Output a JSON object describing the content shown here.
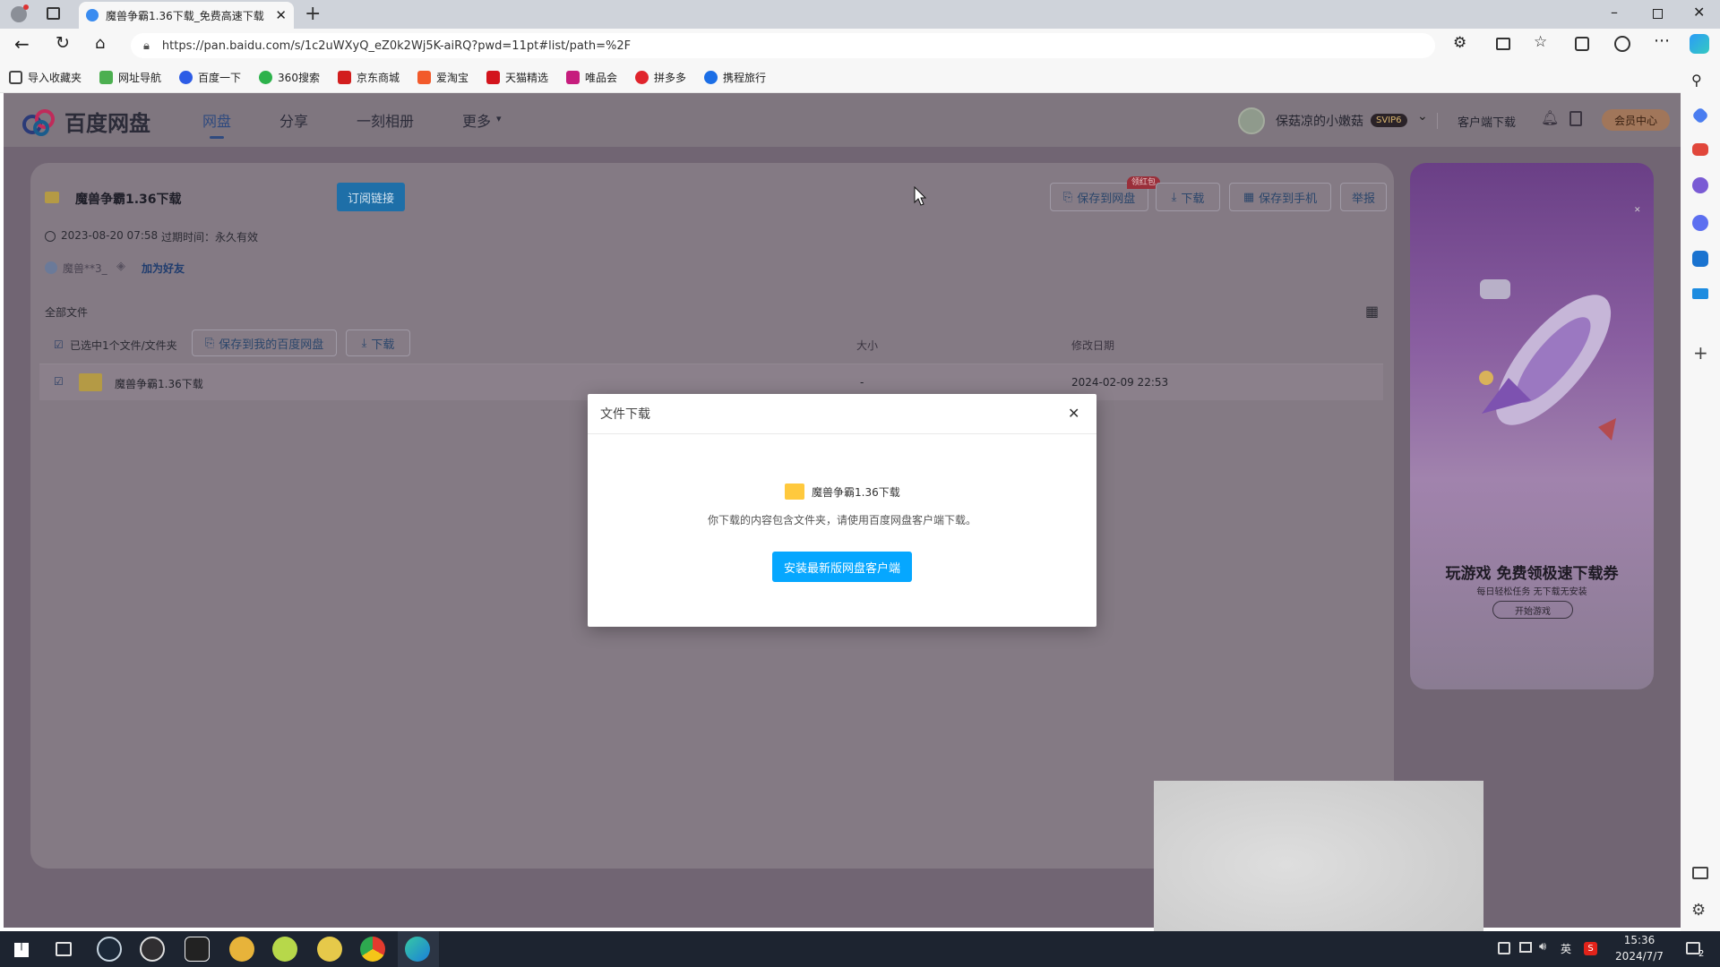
{
  "browser": {
    "tab_title": "魔兽争霸1.36下载_免费高速下载",
    "url": "https://pan.baidu.com/s/1c2uWXyQ_eZ0k2Wj5K-aiRQ?pwd=11pt#list/path=%2F",
    "bookmarks": [
      "导入收藏夹",
      "网址导航",
      "百度一下",
      "360搜索",
      "京东商城",
      "爱淘宝",
      "天猫精选",
      "唯品会",
      "拼多多",
      "携程旅行"
    ]
  },
  "header": {
    "logo_text": "百度网盘",
    "nav": [
      "网盘",
      "分享",
      "一刻相册",
      "更多"
    ],
    "username": "保菇凉的小嫩菇",
    "level_badge": "SVIP6",
    "client_download": "客户端下载",
    "vip_center": "会员中心"
  },
  "share": {
    "title": "魔兽争霸1.36下载",
    "subscribe_btn": "订阅链接",
    "save_to_pan": "保存到网盘",
    "red_packet": "领红包",
    "download": "下载",
    "save_to_phone": "保存到手机",
    "report": "举报",
    "date": "2023-08-20 07:58",
    "expire": "过期时间：永久有效",
    "sharer": "魔兽**3_",
    "add_friend": "加为好友",
    "all_files": "全部文件",
    "selected": "已选中1个文件/文件夹",
    "save_to_my_pan": "保存到我的百度网盘",
    "download2": "下载",
    "col_size": "大小",
    "col_date": "修改日期",
    "row": {
      "name": "魔兽争霸1.36下载",
      "size": "-",
      "date": "2024-02-09 22:53"
    }
  },
  "ad": {
    "headline": "玩游戏 免费领极速下载券",
    "sub": "每日轻松任务 无下载无安装",
    "button": "开始游戏"
  },
  "modal": {
    "title": "文件下载",
    "folder": "魔兽争霸1.36下载",
    "message": "你下载的内容包含文件夹，请使用百度网盘客户端下载。",
    "button": "安装最新版网盘客户端"
  },
  "taskbar": {
    "ime": "英",
    "time": "15:36",
    "date": "2024/7/7",
    "notif_count": "2"
  }
}
